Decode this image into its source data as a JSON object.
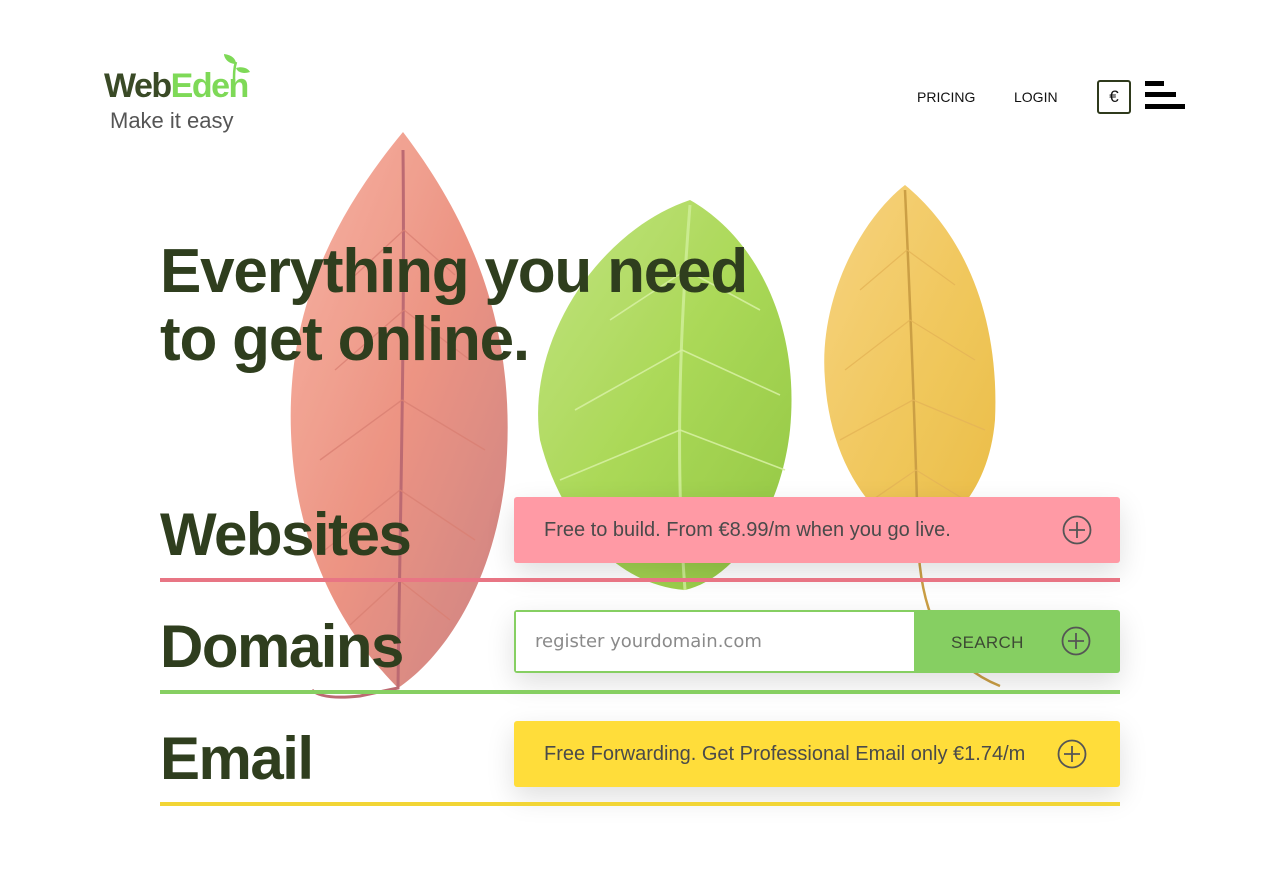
{
  "header": {
    "logo": {
      "name_part1": "Web",
      "name_part2": "Eden",
      "tagline": "Make it easy"
    },
    "nav": [
      {
        "label": "PRICING"
      },
      {
        "label": "LOGIN"
      }
    ],
    "currency_symbol": "€",
    "menu_icon": "hamburger-menu-icon"
  },
  "hero": {
    "headline_line1": "Everything you need",
    "headline_line2": "to get online."
  },
  "sections": {
    "websites": {
      "title": "Websites",
      "offer": "Free to build. From €8.99/m when you go live.",
      "color": "#ff9aa5",
      "icon": "plus-circle-icon"
    },
    "domains": {
      "title": "Domains",
      "placeholder": "register yourdomain.com",
      "button_label": "SEARCH",
      "color": "#86cf62",
      "icon": "plus-circle-icon"
    },
    "email": {
      "title": "Email",
      "offer": "Free Forwarding. Get Professional Email only €1.74/m",
      "color": "#ffdd3a",
      "icon": "plus-circle-icon"
    }
  },
  "colors": {
    "heading": "#2f3e1e",
    "brand_green": "#7ed957",
    "brand_dark": "#3a4a26"
  }
}
